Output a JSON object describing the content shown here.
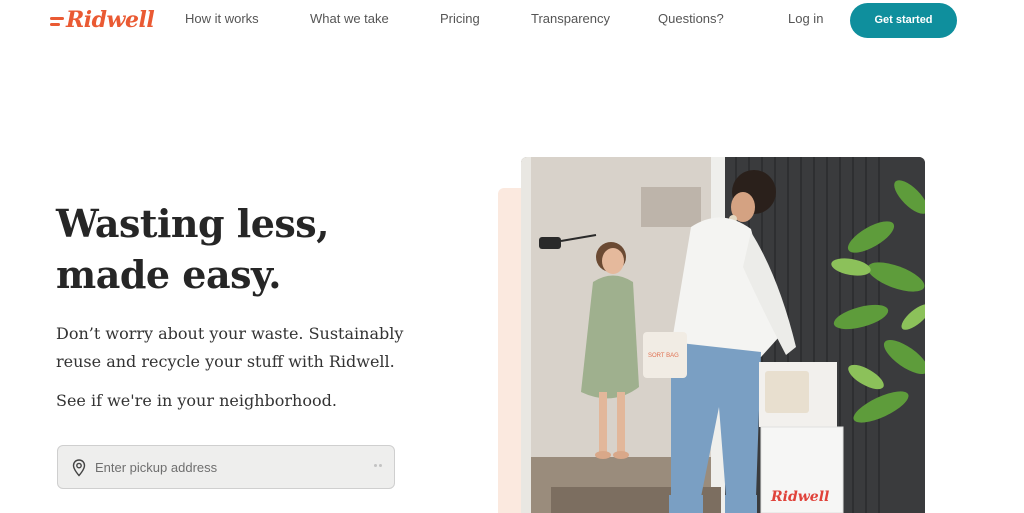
{
  "header": {
    "logo_text": "Ridwell",
    "nav": [
      {
        "label": "How it works"
      },
      {
        "label": "What we take"
      },
      {
        "label": "Pricing"
      },
      {
        "label": "Transparency"
      },
      {
        "label": "Questions?"
      }
    ],
    "login_label": "Log in",
    "cta_label": "Get started"
  },
  "hero": {
    "headline_line1": "Wasting less,",
    "headline_line2": "made easy.",
    "subtext": "Don’t worry about your waste. Sustainably reuse and recycle your stuff with Ridwell.",
    "neighborhood_prompt": "See if we're in your neighborhood.",
    "address_placeholder": "Enter pickup address",
    "bag_label": "SORT BAG",
    "bin_logo": "Ridwell"
  },
  "colors": {
    "brand": "#ea5a33",
    "cta": "#0f8f9d",
    "accent_panel": "#fbe9df"
  },
  "icons": {
    "address_icon": "map-pin-icon",
    "autofill_icon": "dots-icon"
  }
}
